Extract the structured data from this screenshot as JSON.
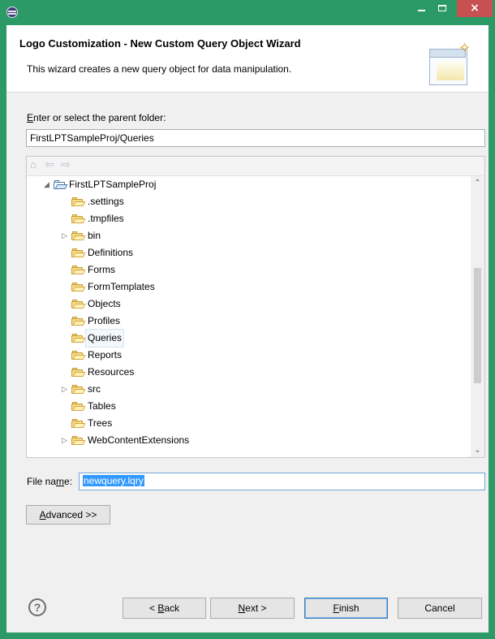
{
  "window": {
    "title": "",
    "close_glyph": "×"
  },
  "header": {
    "title": "Logo Customization - New Custom Query Object Wizard",
    "description": "This wizard creates a new query object for data manipulation."
  },
  "parent_folder": {
    "label_prefix": "E",
    "label_rest": "nter or select the parent folder:",
    "value": "FirstLPTSampleProj/Queries"
  },
  "tree": {
    "nav_icons": [
      "home-icon",
      "back-arrow-icon",
      "forward-arrow-icon"
    ],
    "items": [
      {
        "label": "FirstLPTSampleProj",
        "expanded": true,
        "has_children": true,
        "type": "project"
      },
      {
        "label": ".settings",
        "has_children": false,
        "type": "folder"
      },
      {
        "label": ".tmpfiles",
        "has_children": false,
        "type": "folder"
      },
      {
        "label": "bin",
        "has_children": true,
        "type": "folder"
      },
      {
        "label": "Definitions",
        "has_children": false,
        "type": "folder"
      },
      {
        "label": "Forms",
        "has_children": false,
        "type": "folder"
      },
      {
        "label": "FormTemplates",
        "has_children": false,
        "type": "folder"
      },
      {
        "label": "Objects",
        "has_children": false,
        "type": "folder"
      },
      {
        "label": "Profiles",
        "has_children": false,
        "type": "folder"
      },
      {
        "label": "Queries",
        "has_children": false,
        "type": "folder",
        "selected": true
      },
      {
        "label": "Reports",
        "has_children": false,
        "type": "folder"
      },
      {
        "label": "Resources",
        "has_children": false,
        "type": "folder"
      },
      {
        "label": "src",
        "has_children": true,
        "type": "folder"
      },
      {
        "label": "Tables",
        "has_children": false,
        "type": "folder"
      },
      {
        "label": "Trees",
        "has_children": false,
        "type": "folder"
      },
      {
        "label": "WebContentExtensions",
        "has_children": true,
        "type": "folder"
      }
    ]
  },
  "file_name": {
    "label_prefix": "File na",
    "label_mnemonic": "m",
    "label_suffix": "e:",
    "value": "newquery.lqry"
  },
  "buttons": {
    "advanced_prefix": "A",
    "advanced_rest": "dvanced >>",
    "back_prefix": "< ",
    "back_mnemonic": "B",
    "back_rest": "ack",
    "next_mnemonic": "N",
    "next_rest": "ext >",
    "finish_mnemonic": "F",
    "finish_rest": "inish",
    "cancel": "Cancel",
    "help_glyph": "?"
  },
  "colors": {
    "title_bar": "#2b9a66",
    "close_button": "#c75050",
    "selection": "#3399ff",
    "default_button_border": "#3c7fb1"
  },
  "icons": {
    "app": "eclipse-icon",
    "minimize": "minimize-icon",
    "maximize": "maximize-icon",
    "close": "close-icon",
    "wizard": "wizard-graphic-icon",
    "folder": "folder-icon",
    "project_folder": "project-folder-icon",
    "help": "help-icon"
  }
}
